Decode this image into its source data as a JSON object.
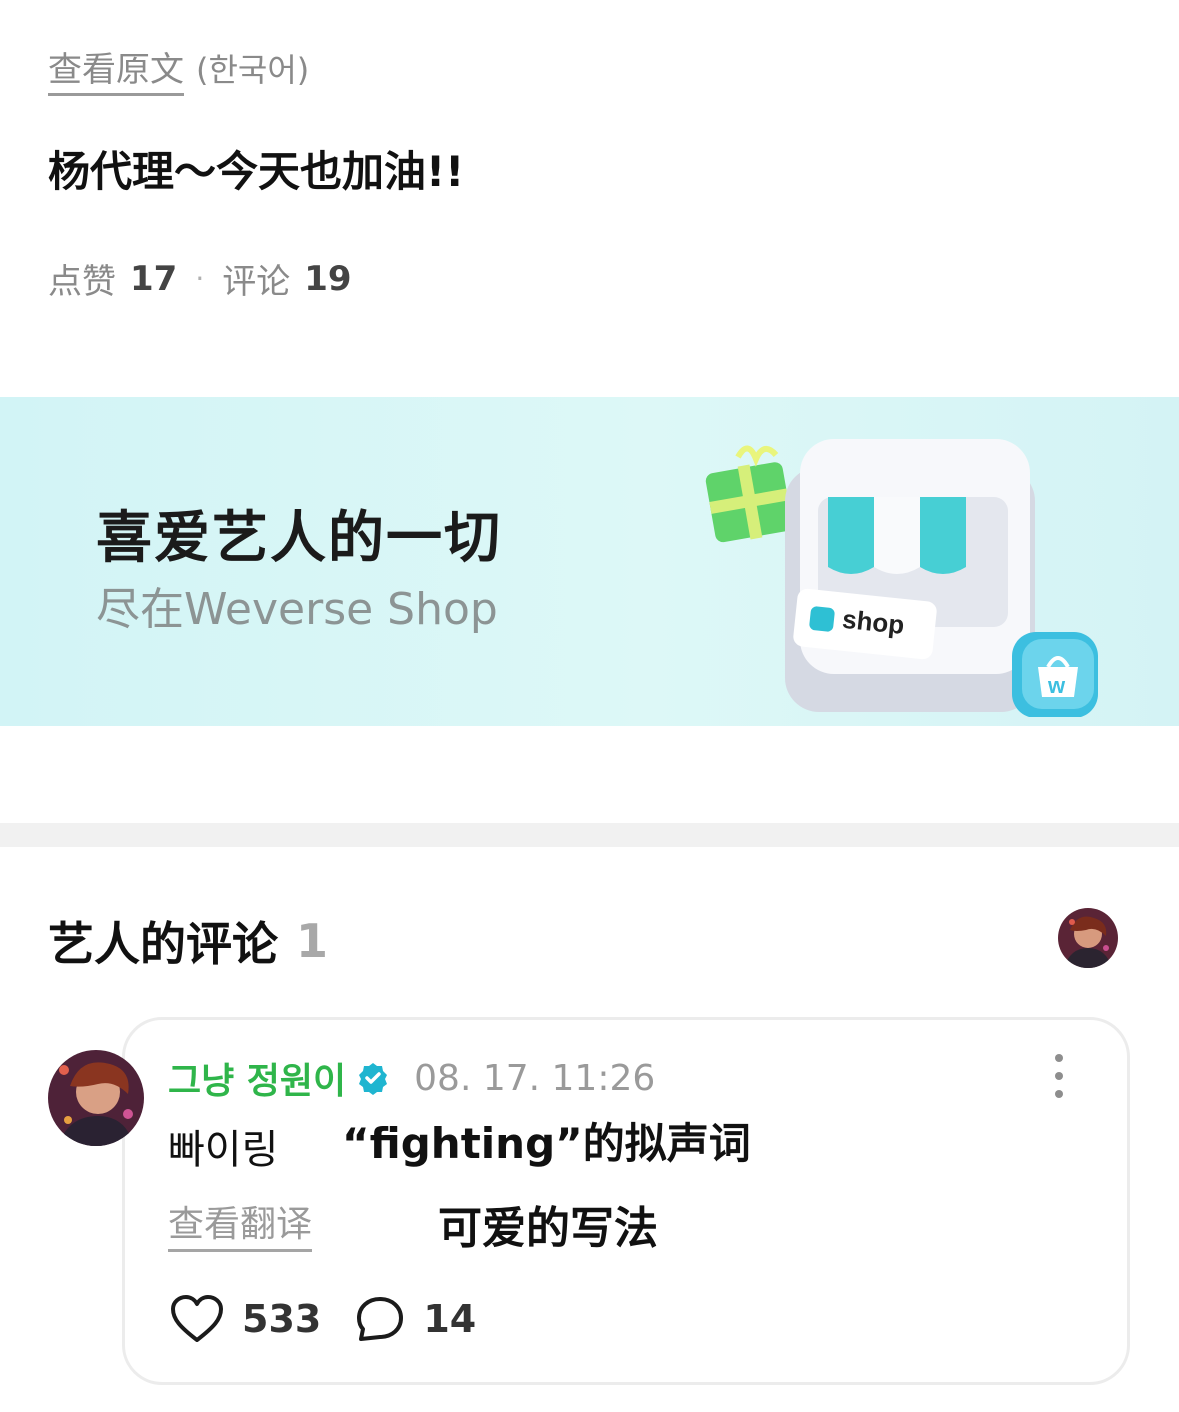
{
  "post": {
    "view_original": "查看原文",
    "original_language": "(한국어)",
    "text": "杨代理～今天也加油!!",
    "likes_label": "点赞",
    "likes_count": "17",
    "separator": "·",
    "comments_label": "评论",
    "comments_count": "19"
  },
  "banner": {
    "title": "喜爱艺人的一切",
    "subtitle": "尽在Weverse Shop",
    "shop_sign": "shop",
    "bag_letter": "w",
    "icons": [
      "gift-icon",
      "shop-storefront-icon",
      "shopping-bag-icon"
    ]
  },
  "artist_comments": {
    "title": "艺人的评论",
    "count": "1"
  },
  "comment": {
    "author": "그냥 정원이",
    "timestamp": "08. 17. 11:26",
    "text": "빠이링",
    "view_translation": "查看翻译",
    "likes": "533",
    "replies": "14",
    "verified_color": "#1fb5d0",
    "author_color": "#2fb54a"
  },
  "captions": {
    "line1": "“fighting”的拟声词",
    "line2": "可爱的写法"
  }
}
